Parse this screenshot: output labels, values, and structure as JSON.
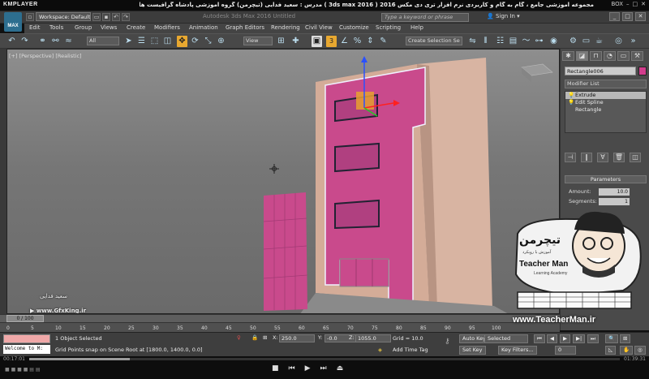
{
  "player": {
    "logo": "KMPLAYER",
    "title": "مجموعه آموزشی جامع ، گام به گام و کاربردی نرم افزار تری دی مکس 2016 ( 3ds max 2016 )  مدرس : سعید فدایی (تیچرمن) گروه آموزشی پادشاه گرافیست ها",
    "right_label": "BOX",
    "time_elapsed": "00:17:01",
    "time_total": "01:39:31",
    "progress": 0.171
  },
  "app": {
    "logo": "MAX",
    "workspace": "Workspace: Default",
    "title": "Autodesk 3ds Max 2016    Untitled",
    "search_placeholder": "Type a keyword or phrase",
    "sign_in": "Sign In"
  },
  "menu": [
    "Edit",
    "Tools",
    "Group",
    "Views",
    "Create",
    "Modifiers",
    "Animation",
    "Graph Editors",
    "Rendering",
    "Civil View",
    "Customize",
    "Scripting",
    "Help"
  ],
  "toolbar": {
    "filter": "All",
    "refcoord": "View",
    "snap_label": "3",
    "selection_set": "Create Selection Se"
  },
  "viewport": {
    "label": "[+] [Perspective] [Realistic]",
    "object_color": "#d23c8c"
  },
  "watermark": {
    "signature": "سعید فدایی",
    "site": "www.GfxKing.ir"
  },
  "teacherman": {
    "logo_fa": "تیچرمن",
    "tagline_fa": "آموزش با رویکرد",
    "name": "Teacher Man",
    "sub": "Learning Academy",
    "url": "www.TeacherMan.ir"
  },
  "command_panel": {
    "object_name": "Rectangle006",
    "modifier_list": "Modifier List",
    "stack": [
      "Extrude",
      "Edit Spline",
      "Rectangle"
    ],
    "rollout": "Parameters",
    "amount_label": "Amount:",
    "amount_value": "10.0",
    "segments_label": "Segments:",
    "segments_value": "1"
  },
  "timeline": {
    "position": "0 / 100",
    "ticks": [
      "0",
      "5",
      "10",
      "15",
      "20",
      "25",
      "30",
      "35",
      "40",
      "45",
      "50",
      "55",
      "60",
      "65",
      "70",
      "75",
      "80",
      "85",
      "90",
      "95",
      "100"
    ]
  },
  "status": {
    "listener": "Welcome to M:",
    "selection": "1 Object Selected",
    "prompt": "Grid Points snap on Scene Root at [1800.0, 1400.0, 0.0]",
    "x_label": "X:",
    "x_value": "250.0",
    "y_label": "Y:",
    "y_value": "-0.0",
    "z_label": "Z:",
    "z_value": "1055.0",
    "grid": "Grid = 10.0",
    "add_time_tag": "Add Time Tag",
    "auto_key": "Auto Key",
    "selected": "Selected",
    "set_key": "Set Key",
    "key_filters": "Key Filters...",
    "frame": "0"
  }
}
